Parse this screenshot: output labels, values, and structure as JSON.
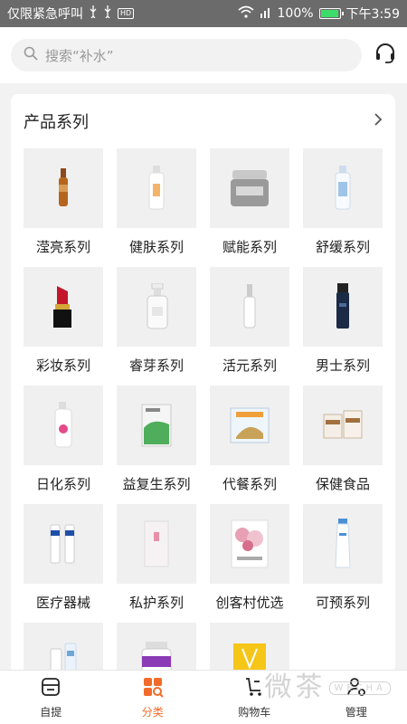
{
  "status_bar": {
    "carrier": "仅限紧急呼叫",
    "battery": "100%",
    "time": "下午3:59",
    "hd": "HD"
  },
  "search": {
    "placeholder": "搜索“补水”"
  },
  "category": {
    "title": "产品系列",
    "items": [
      {
        "label": "滢亮系列",
        "icon": "ampoule"
      },
      {
        "label": "健肤系列",
        "icon": "bottle-white"
      },
      {
        "label": "赋能系列",
        "icon": "jar-silver"
      },
      {
        "label": "舒缓系列",
        "icon": "bottle-blue"
      },
      {
        "label": "彩妆系列",
        "icon": "lipstick"
      },
      {
        "label": "睿芽系列",
        "icon": "pump-bottle"
      },
      {
        "label": "活元系列",
        "icon": "dropper-bottle"
      },
      {
        "label": "男士系列",
        "icon": "bottle-navy"
      },
      {
        "label": "日化系列",
        "icon": "spray-bottle"
      },
      {
        "label": "益复生系列",
        "icon": "green-box"
      },
      {
        "label": "代餐系列",
        "icon": "meal-box"
      },
      {
        "label": "保健食品",
        "icon": "supplement-boxes"
      },
      {
        "label": "医疗器械",
        "icon": "tubes"
      },
      {
        "label": "私护系列",
        "icon": "pink-package"
      },
      {
        "label": "创客村优选",
        "icon": "floral-pack"
      },
      {
        "label": "可预系列",
        "icon": "tube-blue"
      },
      {
        "label": "",
        "icon": "bottles-blue"
      },
      {
        "label": "",
        "icon": "pill-jar"
      },
      {
        "label": "",
        "icon": "yellow-bag"
      }
    ]
  },
  "tabs": [
    {
      "label": "自提",
      "icon": "store-icon"
    },
    {
      "label": "分类",
      "icon": "category-icon",
      "active": true
    },
    {
      "label": "购物车",
      "icon": "cart-icon"
    },
    {
      "label": "管理",
      "icon": "manage-icon"
    }
  ],
  "watermark": {
    "text": "微茶",
    "tag": "WECHA"
  },
  "colors": {
    "accent": "#f26b2a",
    "status_bar": "#6b6b6b",
    "thumb_bg": "#f0f0f0"
  }
}
